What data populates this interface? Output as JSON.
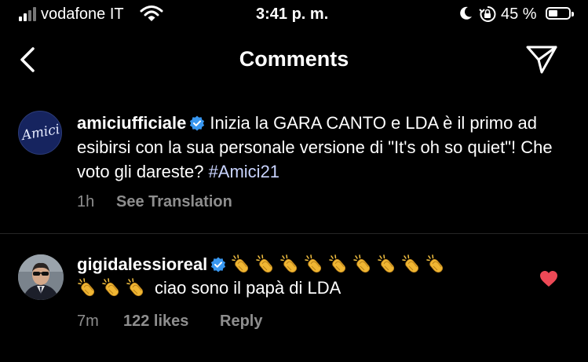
{
  "status_bar": {
    "carrier": "vodafone IT",
    "time": "3:41 p. m.",
    "battery_percent": "45 %",
    "battery_level": 0.45,
    "icons": [
      "signal-icon",
      "wifi-icon",
      "moon-icon",
      "orientation-lock-icon",
      "battery-icon"
    ]
  },
  "nav": {
    "title": "Comments",
    "icons": [
      "back-chevron-icon",
      "send-icon"
    ]
  },
  "caption": {
    "username": "amiciufficiale",
    "verified": true,
    "text": "Inizia la GARA CANTO e LDA è il primo ad esibirsi con la sua personale versione di \"It's oh so quiet\"! Che voto gli dareste?",
    "hashtag": "#Amici21",
    "time_ago": "1h",
    "see_translation": "See Translation",
    "avatar_logo_text": "Amici"
  },
  "comment": {
    "username": "gigidalessioreal",
    "verified": true,
    "emoji": "👏",
    "emoji_count_line1": 9,
    "emoji_count_line2": 3,
    "text": "ciao sono il papà di LDA",
    "time_ago": "7m",
    "likes": "122 likes",
    "reply_label": "Reply",
    "liked": true
  },
  "colors": {
    "background": "#000000",
    "text": "#ffffff",
    "meta": "#8e8e8e",
    "verified": "#3897f0",
    "heart": "#ed4956",
    "hashtag": "#c9d4ff",
    "divider": "#262626"
  }
}
